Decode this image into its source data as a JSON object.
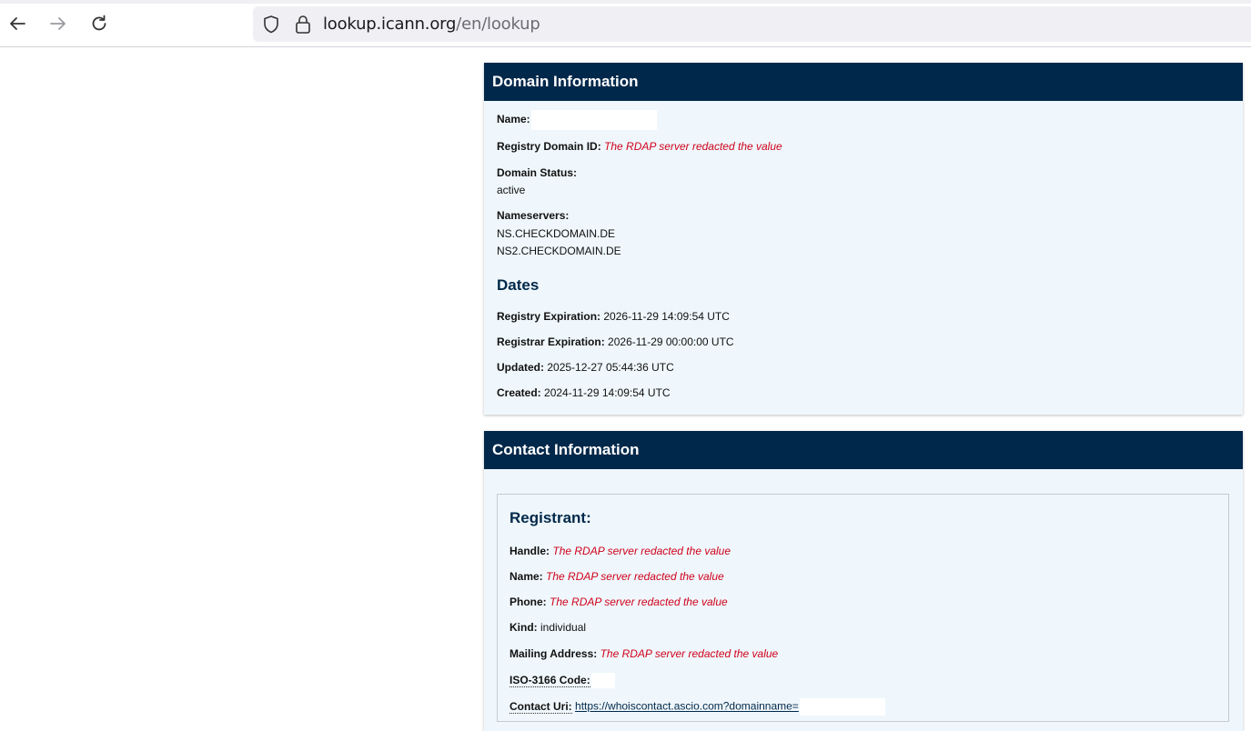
{
  "browser": {
    "url_host": "lookup.icann.org",
    "url_path": "/en/lookup"
  },
  "domain_info": {
    "header": "Domain Information",
    "name_label": "Name:",
    "registry_id_label": "Registry Domain ID:",
    "registry_id_value": "The RDAP server redacted the value",
    "status_label": "Domain Status:",
    "status_value": "active",
    "nameservers_label": "Nameservers:",
    "nameservers": [
      "NS.CHECKDOMAIN.DE",
      "NS2.CHECKDOMAIN.DE"
    ],
    "dates_title": "Dates",
    "dates": [
      {
        "label": "Registry Expiration:",
        "value": "2026-11-29 14:09:54 UTC"
      },
      {
        "label": "Registrar Expiration:",
        "value": "2026-11-29 00:00:00 UTC"
      },
      {
        "label": "Updated:",
        "value": "2025-12-27 05:44:36 UTC"
      },
      {
        "label": "Created:",
        "value": "2024-11-29 14:09:54 UTC"
      }
    ]
  },
  "contact_info": {
    "header": "Contact Information",
    "registrant_title": "Registrant:",
    "handle_label": "Handle:",
    "handle_value": "The RDAP server redacted the value",
    "name_label": "Name:",
    "name_value": "The RDAP server redacted the value",
    "phone_label": "Phone:",
    "phone_value": "The RDAP server redacted the value",
    "kind_label": "Kind:",
    "kind_value": "individual",
    "address_label": "Mailing Address:",
    "address_value": "The RDAP server redacted the value",
    "iso_label": "ISO-3166 Code:",
    "uri_label": "Contact Uri:",
    "uri_value": "https://whoiscontact.ascio.com?domainname="
  },
  "colors": {
    "header_bg": "#00284a",
    "panel_bg": "#eff7fc",
    "redacted": "#d0021b"
  }
}
